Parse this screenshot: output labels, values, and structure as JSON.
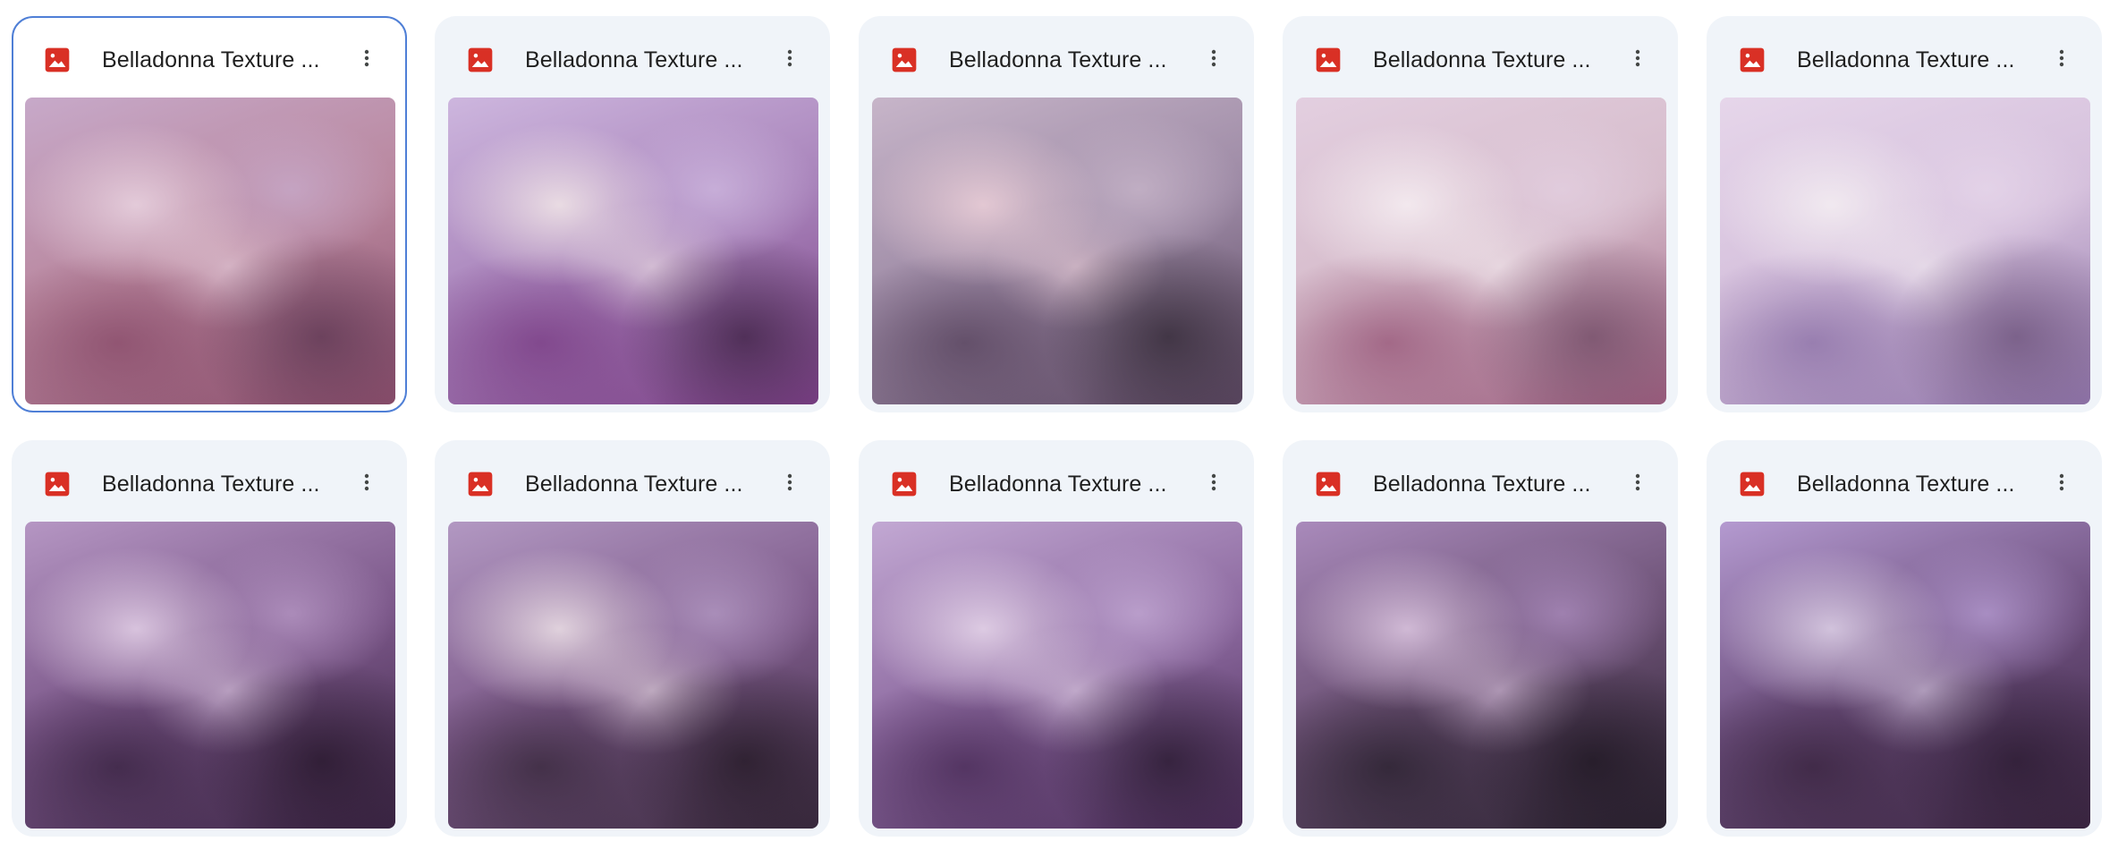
{
  "files": [
    {
      "title": "Belladonna Texture ...",
      "selected": true,
      "icon": "image-file-icon",
      "thumb": {
        "base": "#b9879e",
        "c1": "#e9d3e0",
        "c2": "#8a4d6b",
        "c3": "#c7a9c9",
        "c4": "#5a3550"
      }
    },
    {
      "title": "Belladonna Texture ...",
      "selected": false,
      "icon": "image-file-icon",
      "thumb": {
        "base": "#a883ba",
        "c1": "#f1e6e7",
        "c2": "#7b3f86",
        "c3": "#cdb6de",
        "c4": "#3a2040"
      }
    },
    {
      "title": "Belladonna Texture ...",
      "selected": false,
      "icon": "image-file-icon",
      "thumb": {
        "base": "#9d8aa5",
        "c1": "#ebcfd8",
        "c2": "#5a4660",
        "c3": "#c7b5c9",
        "c4": "#2f2632"
      }
    },
    {
      "title": "Belladonna Texture ...",
      "selected": false,
      "icon": "image-file-icon",
      "thumb": {
        "base": "#d6bccb",
        "c1": "#f6eef2",
        "c2": "#9a5b7c",
        "c3": "#e3cfe0",
        "c4": "#6e4a64"
      }
    },
    {
      "title": "Belladonna Texture ...",
      "selected": false,
      "icon": "image-file-icon",
      "thumb": {
        "base": "#d5c0dc",
        "c1": "#f4eef2",
        "c2": "#8e73a8",
        "c3": "#e6d6ea",
        "c4": "#6a5078"
      }
    },
    {
      "title": "Belladonna Texture ...",
      "selected": false,
      "icon": "image-file-icon",
      "thumb": {
        "base": "#7b5789",
        "c1": "#e3d0e7",
        "c2": "#3b2544",
        "c3": "#b596c3",
        "c4": "#241528"
      }
    },
    {
      "title": "Belladonna Texture ...",
      "selected": false,
      "icon": "image-file-icon",
      "thumb": {
        "base": "#7e5b8b",
        "c1": "#ece0e6",
        "c2": "#3a2a3e",
        "c3": "#b298c2",
        "c4": "#221823"
      }
    },
    {
      "title": "Belladonna Texture ...",
      "selected": false,
      "icon": "image-file-icon",
      "thumb": {
        "base": "#8d6aa0",
        "c1": "#e6d6ea",
        "c2": "#4a2c58",
        "c3": "#c2a8d3",
        "c4": "#25172b"
      }
    },
    {
      "title": "Belladonna Texture ...",
      "selected": false,
      "icon": "image-file-icon",
      "thumb": {
        "base": "#6c5175",
        "c1": "#dcc6e0",
        "c2": "#2b2230",
        "c3": "#a98abb",
        "c4": "#1c151f"
      }
    },
    {
      "title": "Belladonna Texture ...",
      "selected": false,
      "icon": "image-file-icon",
      "thumb": {
        "base": "#6d4f7e",
        "c1": "#ddd0e6",
        "c2": "#3a2540",
        "c3": "#b49ad0",
        "c4": "#2a1a30"
      }
    }
  ],
  "colors": {
    "card_bg": "#f0f4f9",
    "selected_border": "#4f7fd6",
    "icon_red": "#d93025",
    "title_text": "#1f1f1f",
    "more_icon": "#444746"
  }
}
